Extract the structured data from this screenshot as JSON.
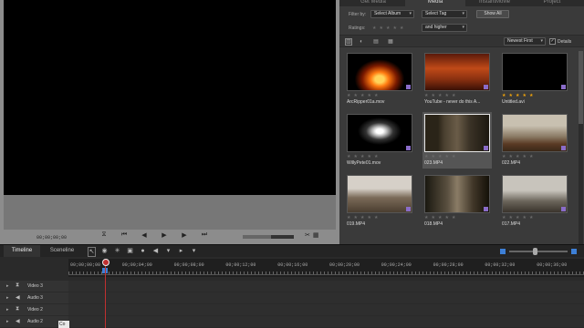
{
  "monitor": {
    "timecode": "00;00;00;00",
    "transport_icons": [
      "scissors-split",
      "go-start",
      "step-back",
      "play",
      "step-forward",
      "go-end"
    ],
    "transport_glyphs": [
      "⧖",
      "⏮",
      "◀",
      "▶",
      "▶",
      "⏭"
    ],
    "tool_glyphs": [
      "✂",
      "▦"
    ],
    "scrub_fraction": 0.55
  },
  "organizer": {
    "tabs": [
      {
        "label": "Get Media",
        "active": false
      },
      {
        "label": "Media",
        "active": true
      },
      {
        "label": "InstantMovie",
        "active": false
      },
      {
        "label": "Project",
        "active": false
      }
    ],
    "filter_by_label": "Filter by:",
    "album_dropdown": "Select Album",
    "tag_dropdown": "Select Tag",
    "show_all_button": "Show All",
    "ratings_label": "Ratings:",
    "ratings_dropdown": "and higher",
    "sort_dropdown": "Newest First",
    "details_label": "Details",
    "toolbar_glyphs": [
      "▥",
      "◐",
      "▤",
      "▦"
    ]
  },
  "clips": [
    {
      "name": "ArcRipper01a.mov",
      "stars": 0,
      "selected": false,
      "kind": "fire"
    },
    {
      "name": "YouTube - never do this A...",
      "stars": 0,
      "selected": false,
      "kind": "orange"
    },
    {
      "name": "Untitled.avi",
      "stars": 5,
      "selected": false,
      "kind": "black"
    },
    {
      "name": "WillyPete01.mov",
      "stars": 0,
      "selected": false,
      "kind": "smoke"
    },
    {
      "name": "023.MP4",
      "stars": 0,
      "selected": true,
      "kind": "hallway"
    },
    {
      "name": "022.MP4",
      "stars": 0,
      "selected": false,
      "kind": "room"
    },
    {
      "name": "019.MP4",
      "stars": 0,
      "selected": false,
      "kind": "room2"
    },
    {
      "name": "018.MP4",
      "stars": 0,
      "selected": false,
      "kind": "hallway2"
    },
    {
      "name": "017.MP4",
      "stars": 0,
      "selected": false,
      "kind": "person"
    }
  ],
  "timeline": {
    "tabs": [
      {
        "label": "Timeline",
        "active": true
      },
      {
        "label": "Sceneline",
        "active": false
      }
    ],
    "tool_glyphs": [
      "↖",
      "◉",
      "✳",
      "▣",
      "●",
      "◀",
      "▾",
      "▸",
      "▾"
    ],
    "ruler_labels": [
      "00;00;00;00",
      "00;00;04;00",
      "00;00;08;00",
      "00;00;12;00",
      "00;00;16;00",
      "00;00;20;00",
      "00;00;24;00",
      "00;00;28;00",
      "00;00;32;00",
      "00;00;36;00"
    ],
    "tracks": [
      {
        "name": "Video 3",
        "icon": "video-track-icon",
        "glyph": "⧗"
      },
      {
        "name": "Audio 3",
        "icon": "audio-track-icon",
        "glyph": "◀"
      },
      {
        "name": "Video 2",
        "icon": "video-track-icon",
        "glyph": "⧗"
      },
      {
        "name": "Audio 2",
        "icon": "audio-track-icon",
        "glyph": "◀"
      }
    ],
    "tooltip": "Co"
  }
}
